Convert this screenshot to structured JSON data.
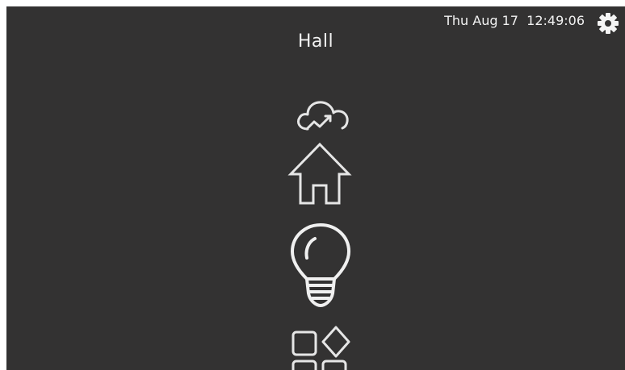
{
  "header": {
    "title": "Hall",
    "datetime": "Thu Aug 17  12:49:06"
  },
  "colors": {
    "background": "#333232",
    "foreground": "#f2f2f2",
    "icon_stroke": "#e6e6e6"
  },
  "icons": {
    "settings": "gear-icon",
    "weather": "cloud-trend-icon",
    "home": "house-icon",
    "lighting": "lightbulb-icon",
    "apps": "apps-grid-icon"
  }
}
